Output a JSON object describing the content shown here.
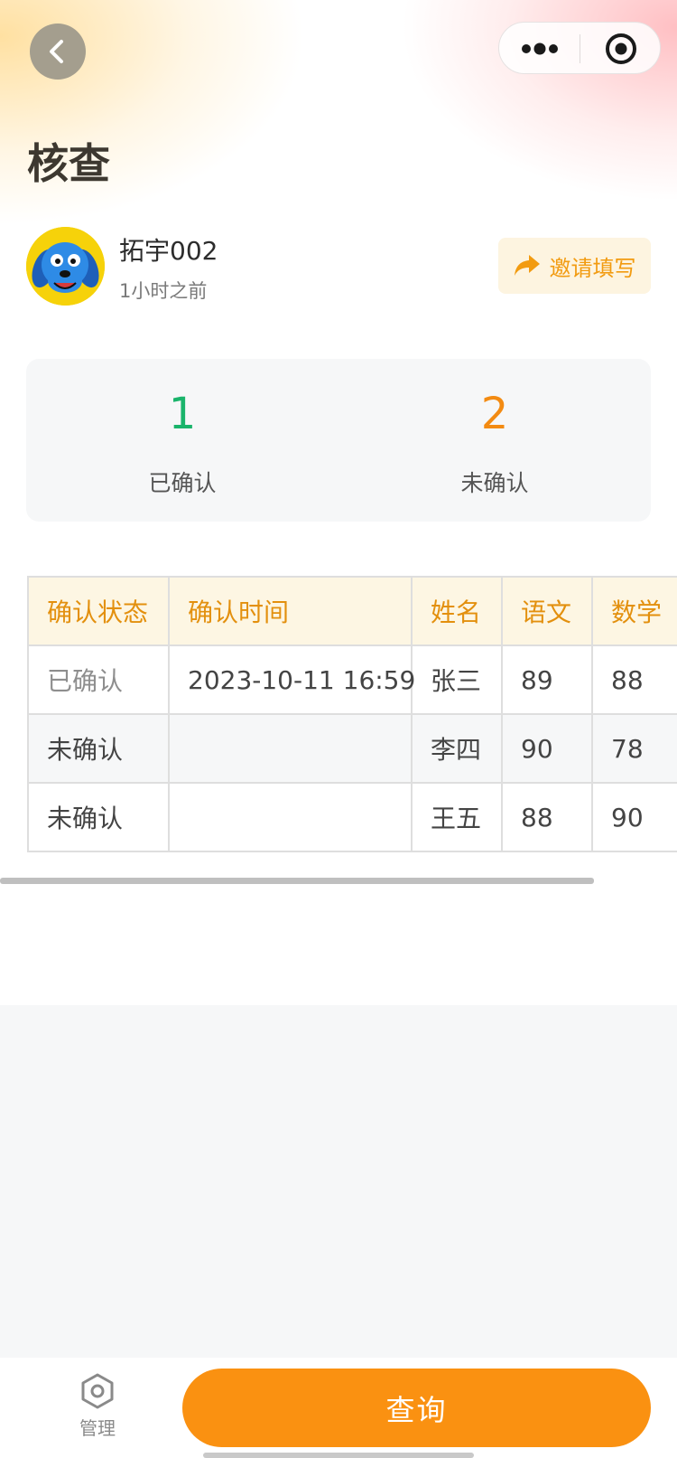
{
  "header": {
    "title": "核查"
  },
  "user": {
    "name": "拓宇002",
    "time_ago": "1小时之前"
  },
  "invite": {
    "label": "邀请填写"
  },
  "stats": {
    "confirmed": {
      "count": "1",
      "label": "已确认",
      "color": "#1ab46b"
    },
    "unconfirmed": {
      "count": "2",
      "label": "未确认",
      "color": "#f38b12"
    }
  },
  "table": {
    "headers": [
      "确认状态",
      "确认时间",
      "姓名",
      "语文",
      "数学"
    ],
    "rows": [
      [
        "已确认",
        "2023-10-11 16:59",
        "张三",
        "89",
        "88"
      ],
      [
        "未确认",
        "",
        "李四",
        "90",
        "78"
      ],
      [
        "未确认",
        "",
        "王五",
        "88",
        "90"
      ]
    ]
  },
  "bottom": {
    "manage_label": "管理",
    "query_label": "查询"
  },
  "colors": {
    "accent": "#fa9111",
    "header_text": "#e3900e"
  }
}
